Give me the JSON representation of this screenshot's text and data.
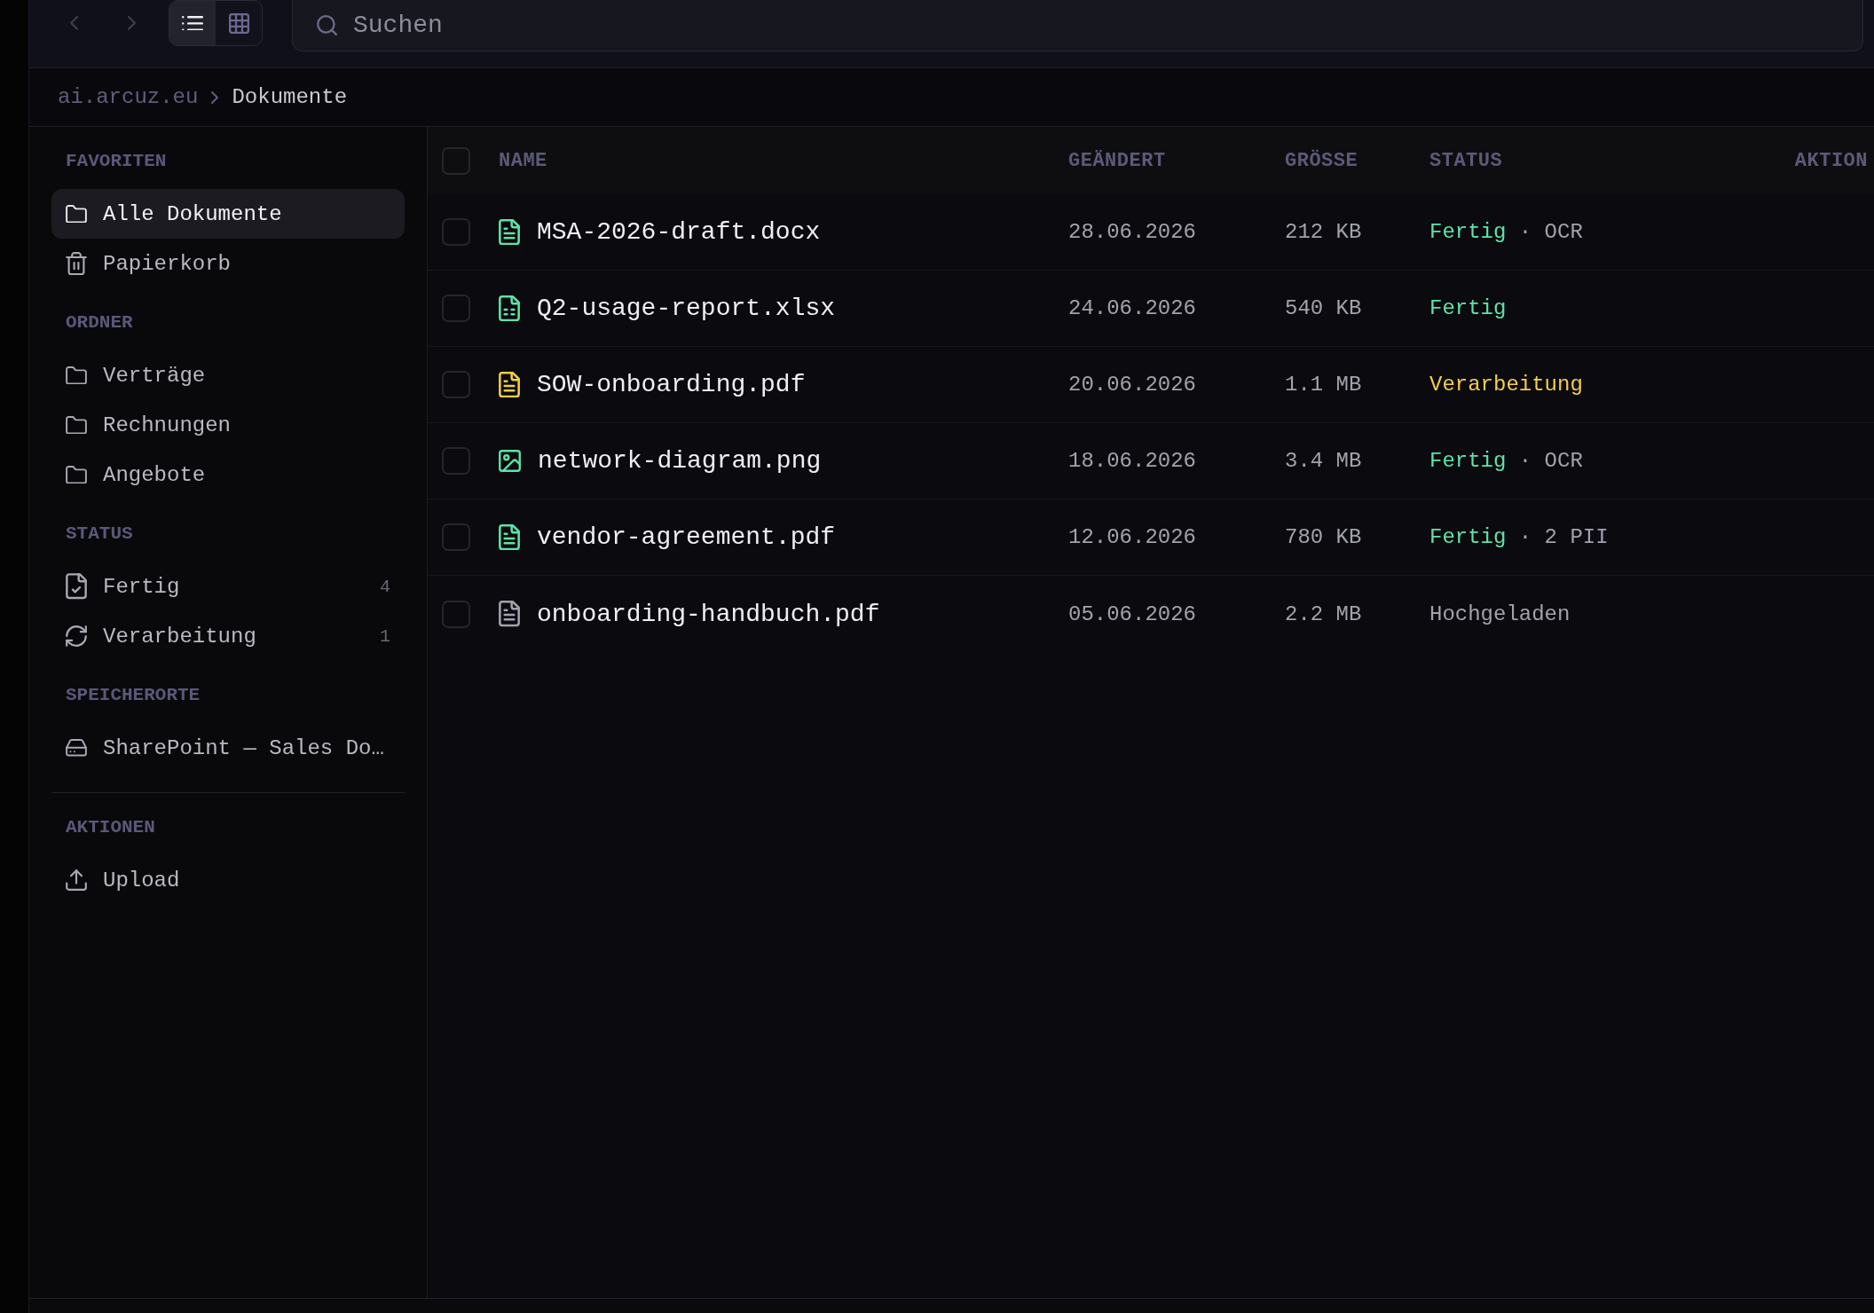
{
  "toolbar": {
    "view_modes": [
      {
        "kind": "list",
        "selected": true
      },
      {
        "kind": "grid",
        "selected": false
      }
    ],
    "search": {
      "placeholder": "Suchen"
    }
  },
  "breadcrumb": [
    {
      "label": "ai.arcuz.eu",
      "current": false
    },
    {
      "label": "Dokumente",
      "current": true
    }
  ],
  "sidebar": {
    "sections": [
      {
        "heading": "FAVORITEN",
        "items": [
          {
            "kind": "folder",
            "label": "Alle Dokumente",
            "selected": true
          },
          {
            "kind": "trash",
            "label": "Papierkorb",
            "selected": false
          }
        ]
      },
      {
        "heading": "ORDNER",
        "items": [
          {
            "kind": "folder",
            "label": "Verträge",
            "selected": false
          },
          {
            "kind": "folder",
            "label": "Rechnungen",
            "selected": false
          },
          {
            "kind": "folder",
            "label": "Angebote",
            "selected": false
          }
        ]
      },
      {
        "heading": "STATUS",
        "items": [
          {
            "kind": "status-done",
            "label": "Fertig",
            "count": "4",
            "selected": false
          },
          {
            "kind": "status-processing",
            "label": "Verarbeitung",
            "count": "1",
            "selected": false
          }
        ]
      },
      {
        "heading": "SPEICHERORTE",
        "items": [
          {
            "kind": "location",
            "label": "SharePoint — Sales Do…",
            "selected": false
          }
        ]
      }
    ],
    "actions": {
      "heading": "AKTIONEN",
      "items": [
        {
          "kind": "upload",
          "label": "Upload"
        }
      ]
    }
  },
  "table": {
    "select_all": {
      "checked": false
    },
    "columns": [
      "NAME",
      "GEÄNDERT",
      "GRÖSSE",
      "STATUS",
      "AKTION"
    ],
    "rows": [
      {
        "checked": false,
        "kind": "document",
        "name": "MSA-2026-draft.docx",
        "modified": "28.06.2026",
        "size": "212 KB",
        "status": "Fertig",
        "color": "#5fe3a9",
        "note": "· OCR"
      },
      {
        "checked": false,
        "kind": "spreadsheet",
        "name": "Q2-usage-report.xlsx",
        "modified": "24.06.2026",
        "size": "540 KB",
        "status": "Fertig",
        "color": "#5fe3a9"
      },
      {
        "checked": false,
        "kind": "document",
        "name": "SOW-onboarding.pdf",
        "modified": "20.06.2026",
        "size": "1.1 MB",
        "status": "Verarbeitung",
        "color": "#f5cd47"
      },
      {
        "checked": false,
        "kind": "image",
        "name": "network-diagram.png",
        "modified": "18.06.2026",
        "size": "3.4 MB",
        "status": "Fertig",
        "color": "#5fe3a9",
        "note": "· OCR"
      },
      {
        "checked": false,
        "kind": "document",
        "name": "vendor-agreement.pdf",
        "modified": "12.06.2026",
        "size": "780 KB",
        "status": "Fertig",
        "color": "#5fe3a9",
        "note": "· 2 PII"
      },
      {
        "checked": false,
        "kind": "document",
        "name": "onboarding-handbuch.pdf",
        "modified": "05.06.2026",
        "size": "2.2 MB",
        "status": "Hochgeladen",
        "color": "#a3a2ad"
      }
    ]
  }
}
